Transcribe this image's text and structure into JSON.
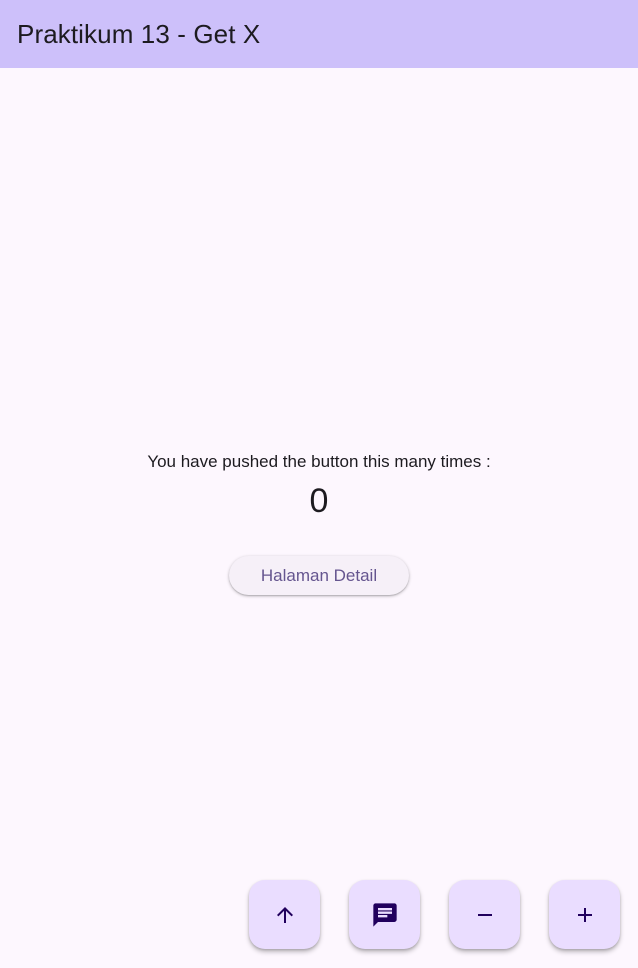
{
  "app_bar": {
    "title": "Praktikum 13 - Get X",
    "color": "#cdc0fa"
  },
  "body": {
    "caption": "You have pushed the button this many times :",
    "counter": "0",
    "detail_button_label": "Halaman Detail"
  },
  "fabs": [
    {
      "name": "arrow-up-icon"
    },
    {
      "name": "message-icon"
    },
    {
      "name": "minus-icon"
    },
    {
      "name": "plus-icon"
    }
  ],
  "colors": {
    "background": "#fdf7fe",
    "fab": "#eaddff",
    "fab_icon": "#21005d",
    "button_text": "#65558f"
  }
}
